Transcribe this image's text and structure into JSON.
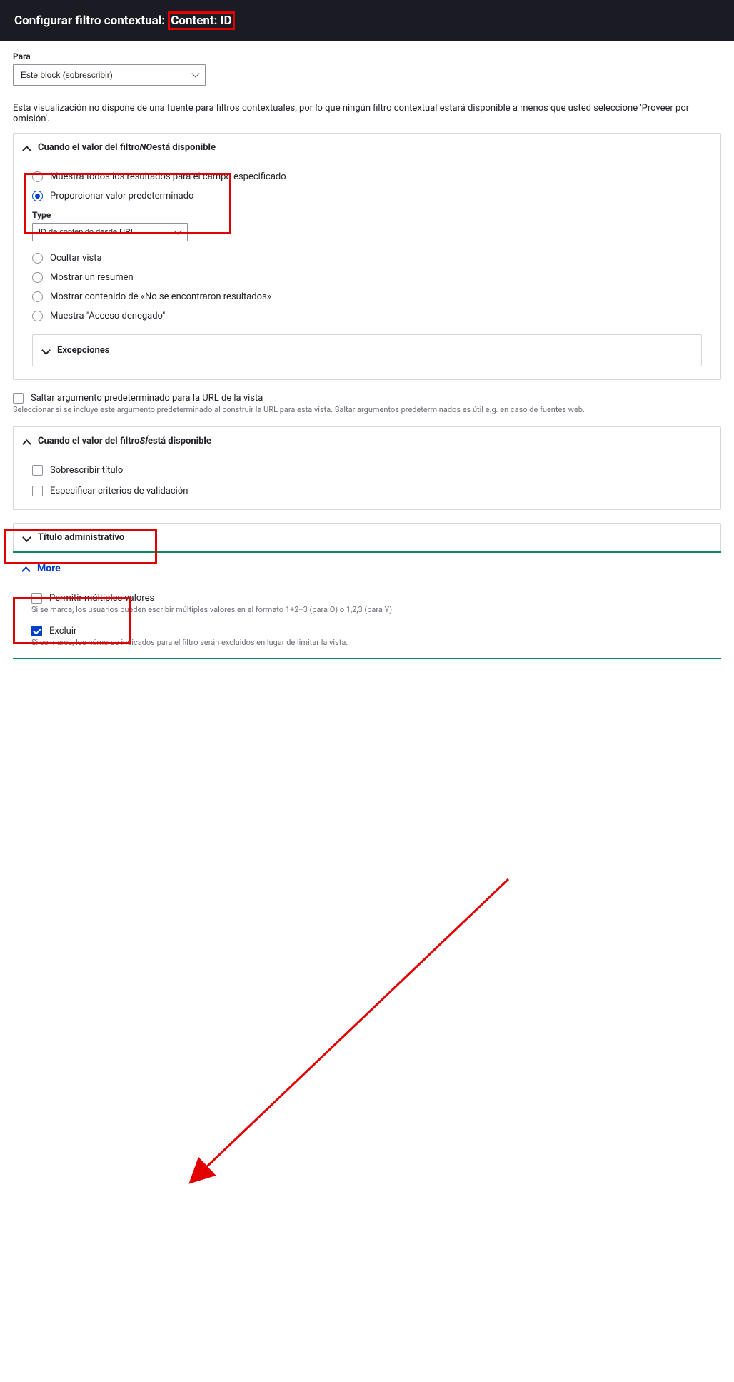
{
  "header": {
    "title_prefix": "Configurar filtro contextual:",
    "title_highlight": "Content: ID"
  },
  "para": {
    "label": "Para",
    "value": "Este block (sobrescribir)"
  },
  "info": "Esta visualización no dispone de una fuente para filtros contextuales, por lo que ningún filtro contextual estará disponible a menos que usted seleccione 'Proveer por omisión'.",
  "panel_no": {
    "title_pre": "Cuando el valor del filtro ",
    "title_em": "NO",
    "title_post": " está disponible",
    "radios": {
      "show_all": "Muestra todos los resultados para el campo especificado",
      "provide_default": "Proporcionar valor predeterminado",
      "hide": "Ocultar vista",
      "summary": "Mostrar un resumen",
      "no_results": "Mostrar contenido de «No se encontraron resultados»",
      "denied": "Muestra \"Acceso denegado\""
    },
    "type_label": "Type",
    "type_value": "ID de contenido desde URL",
    "exceptions": "Excepciones"
  },
  "skip": {
    "label": "Saltar argumento predeterminado para la URL de la vista",
    "help": "Seleccionar si se incluye este argumento predeterminado al construir la URL para esta vista. Saltar argumentos predeterminados es útil e.g. en caso de fuentes web."
  },
  "panel_yes": {
    "title_pre": "Cuando el valor del filtro ",
    "title_em": "SÍ",
    "title_post": " está disponible",
    "overwrite": "Sobrescribir título",
    "validate": "Especificar criterios de validación"
  },
  "admin_title": "Título administrativo",
  "more": {
    "title": "More",
    "allow_multiple": "Permitir múltiples valores",
    "allow_help": "Si se marca, los usuarios pueden escribir múltiples valores en el formato 1+2+3 (para O) o 1,2,3 (para Y).",
    "exclude": "Excluir",
    "exclude_help": "Si se marca, los números indicados para el filtro serán excluidos en lugar de limitar la vista."
  }
}
